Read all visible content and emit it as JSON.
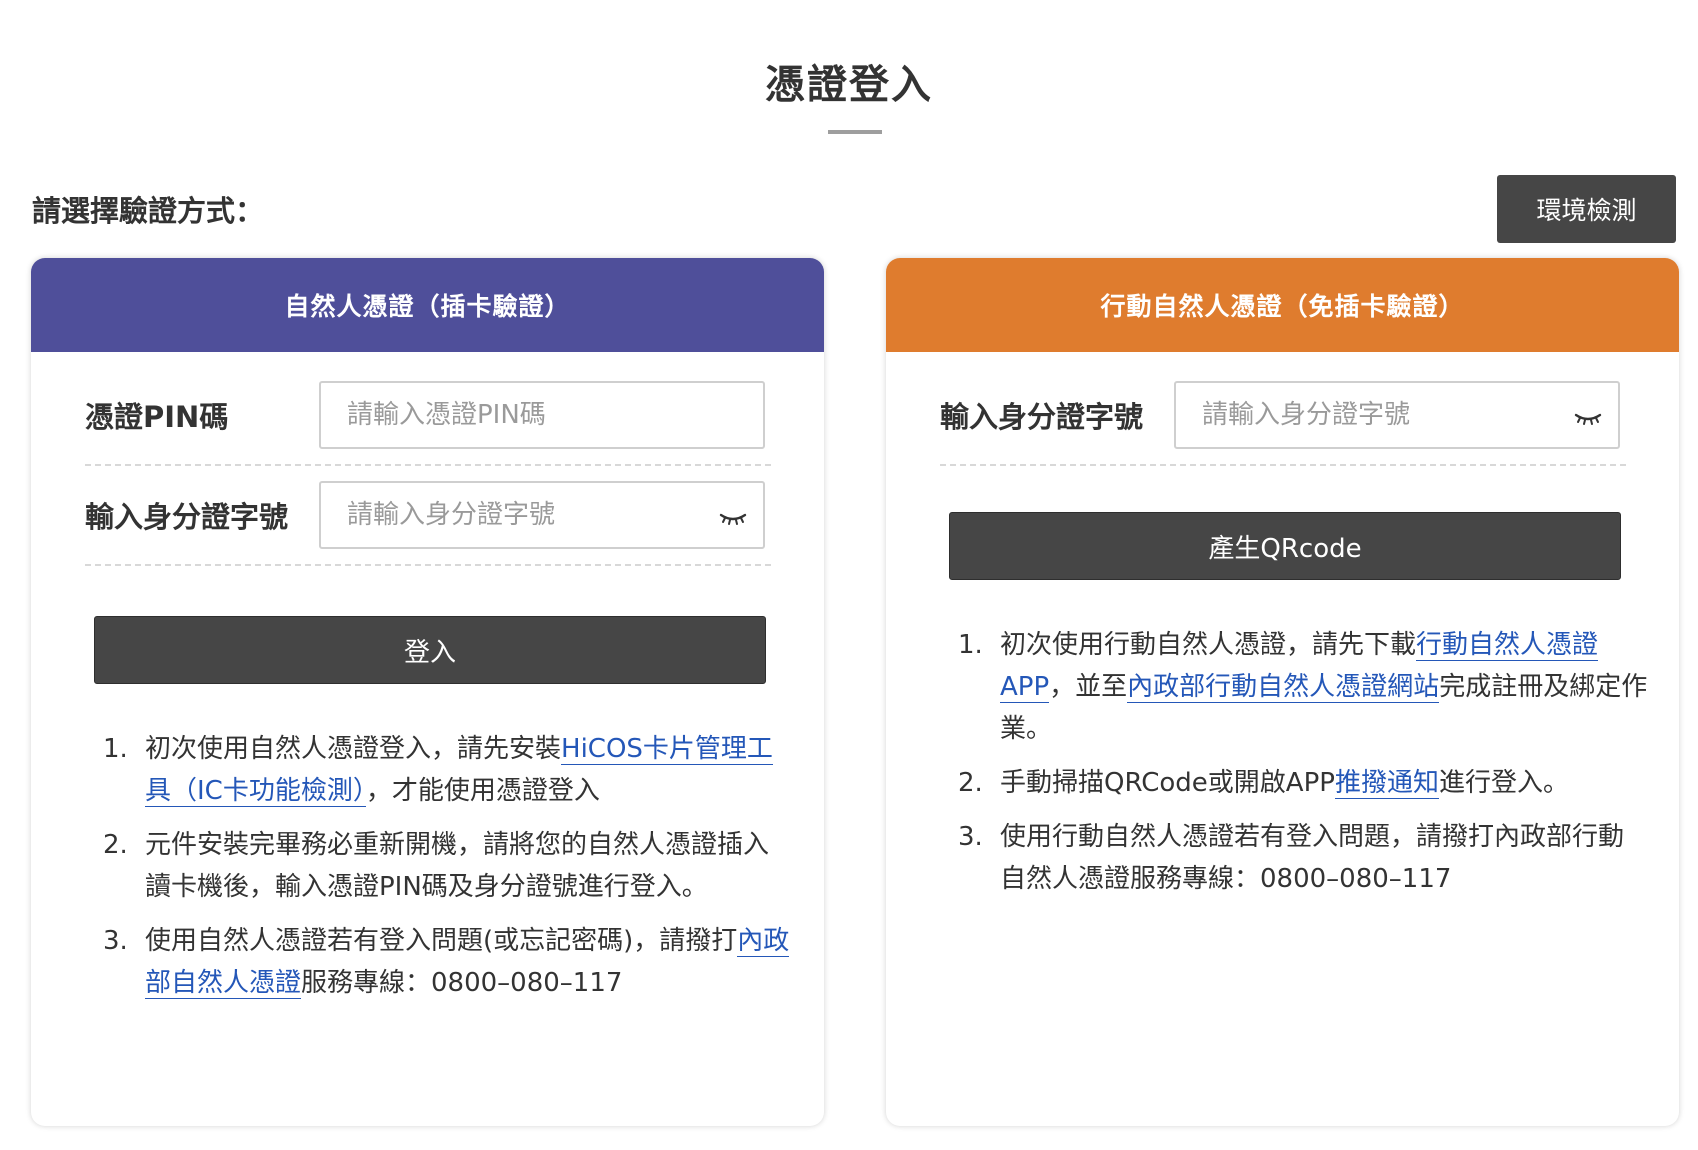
{
  "page": {
    "title": "憑證登入",
    "choose_label": "請選擇驗證方式：",
    "env_button": "環境檢測"
  },
  "left_card": {
    "header": "自然人憑證（插卡驗證）",
    "pin": {
      "label": "憑證PIN碼",
      "placeholder": "請輸入憑證PIN碼"
    },
    "id_number": {
      "label": "輸入身分證字號",
      "placeholder": "請輸入身分證字號"
    },
    "login_button": "登入",
    "notes": [
      {
        "num": "1.",
        "before": "初次使用自然人憑證登入，請先安裝",
        "link": "HiCOS卡片管理工具（IC卡功能檢測）",
        "after": "，才能使用憑證登入"
      },
      {
        "num": "2.",
        "text": "元件安裝完畢務必重新開機，請將您的自然人憑證插入讀卡機後，輸入憑證PIN碼及身分證號進行登入。"
      },
      {
        "num": "3.",
        "before": "使用自然人憑證若有登入問題(或忘記密碼)，請撥打",
        "link": "內政部自然人憑證",
        "after": "服務專線：0800–080–117"
      }
    ]
  },
  "right_card": {
    "header": "行動自然人憑證（免插卡驗證）",
    "id_number": {
      "label": "輸入身分證字號",
      "placeholder": "請輸入身分證字號"
    },
    "qr_button": "產生QRcode",
    "notes": [
      {
        "num": "1.",
        "before": "初次使用行動自然人憑證，請先下載",
        "link": "行動自然人憑證APP",
        "middle": "，並至",
        "link2": "內政部行動自然人憑證網站",
        "after": "完成註冊及綁定作業。"
      },
      {
        "num": "2.",
        "before": "手動掃描QRCode或開啟APP",
        "link": "推撥通知",
        "after": "進行登入。"
      },
      {
        "num": "3.",
        "text": "使用行動自然人憑證若有登入問題，請撥打內政部行動自然人憑證服務專線：0800–080–117"
      }
    ]
  },
  "colors": {
    "left_header": "#4f4f9a",
    "right_header": "#df7c2e",
    "button_dark": "#464646",
    "link": "#2457b8"
  },
  "icons": {
    "password_toggle": "eye-closed-icon"
  }
}
